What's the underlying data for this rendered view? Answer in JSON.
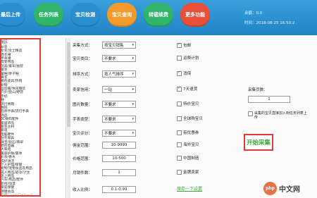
{
  "nav": [
    {
      "label": "最后上传",
      "color": "#2a8ed0"
    },
    {
      "label": "任务列表",
      "color": "#2fb46a"
    },
    {
      "label": "宝贝检测",
      "color": "#2a8ed0"
    },
    {
      "label": "宝贝查询",
      "color": "#f39a2d"
    },
    {
      "label": "转载续费",
      "color": "#2fb46a"
    },
    {
      "label": "更多功能",
      "color": "#e8503a"
    }
  ],
  "header": {
    "account": "余额：0.0",
    "datetime": "时间：2018-08-25 16:50:2"
  },
  "tree": {
    "items": [
      "连接",
      "传达",
      "女装",
      "女装/女士精品",
      "连衣裙",
      "半身裙",
      "母婴用品",
      "玩具/童车/益智",
      "童装",
      "童鞋/亲子鞋",
      "男装",
      "箱包皮具/热销",
      "女鞋",
      "运动服/休闲服装",
      "户外/登山/野营",
      "手机",
      "鞋",
      "流行男鞋",
      "数码",
      "品牌手表/流行手表",
      "饰品",
      "3C数码配件",
      "家居饰品",
      "家装主材",
      "家电",
      "电脑硬件",
      "住宅家具",
      "珠宝/钻石/翡翠",
      "厨房电器",
      "大家电",
      "美容护肤/美体",
      "彩妆/香水",
      "洗护清洁",
      "个人护理/保健",
      "宠物/宠物食品及用品",
      "成人用品/避孕/计生",
      "床上用品",
      "汽车/用品/配件",
      "影视/动漫",
      "家庭保健",
      "保健食品"
    ],
    "footer": "品牌二一ハロ•ル一ド"
  },
  "form": {
    "collect_mode": {
      "label": "采集方式：",
      "value": "按宝贝销售"
    },
    "category": {
      "label": "宝贝类目：",
      "value": "不要求"
    },
    "sort": {
      "label": "排序方式：",
      "value": "按人气排序"
    },
    "seller_credit": {
      "label": "卖家信用：",
      "value": "一钻"
    },
    "shop_type": {
      "label": "图片数量：",
      "value": "不要求"
    },
    "stock": {
      "label": "手表类型：",
      "value": "不要求"
    },
    "rating": {
      "label": "宝贝评分：",
      "value": "不要求"
    },
    "commission": {
      "label": "佣金范围：",
      "value": "10-9999"
    },
    "price": {
      "label": "价格范围：",
      "value": "10-500"
    },
    "sales": {
      "label": "月销件数：",
      "value": "1"
    },
    "ratio": {
      "label": "收入比例：",
      "value": "0.1-0.99"
    }
  },
  "checks": [
    {
      "label": "包邮",
      "checked": true
    },
    {
      "label": "运费计划",
      "checked": false
    },
    {
      "label": "消保",
      "checked": true
    },
    {
      "label": "7天退货",
      "checked": true
    },
    {
      "label": "特价宝贝",
      "checked": false
    },
    {
      "label": "全球购宝贝",
      "checked": false
    },
    {
      "label": "有优惠券",
      "checked": false
    },
    {
      "label": "海外宝贝",
      "checked": false
    },
    {
      "label": "中国制造",
      "checked": false
    },
    {
      "label": "金牌卖家",
      "checked": false
    }
  ],
  "right": {
    "count_label": "采集页数：",
    "count_value": "1",
    "auto_add_label": "采集的宝贝直接加入到任务列表上传",
    "collect_button": "开始采集"
  },
  "link_text": "保存一下设置",
  "watermark": {
    "badge": "php",
    "text": "中文网"
  }
}
